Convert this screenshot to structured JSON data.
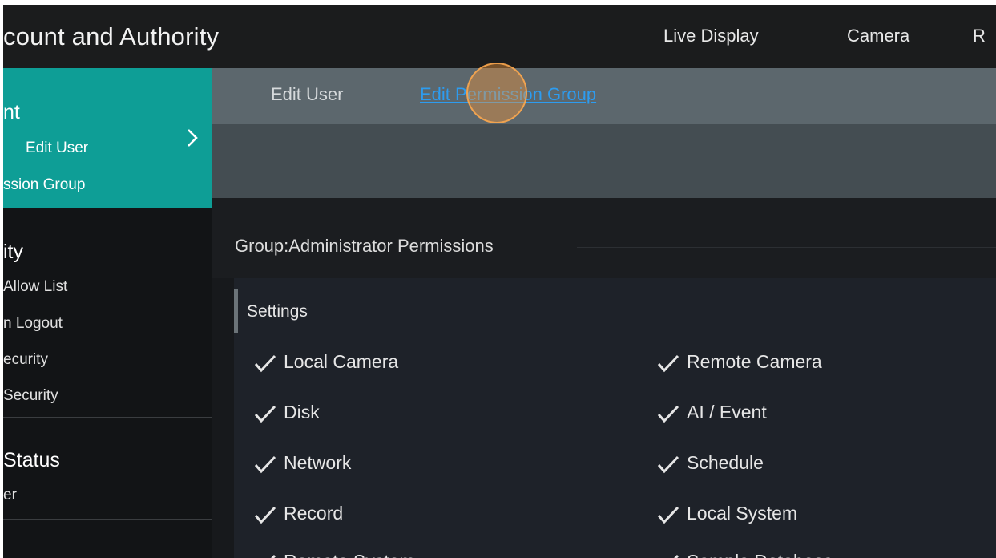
{
  "header": {
    "title": "count and Authority",
    "nav": [
      "Live Display",
      "Camera",
      "R"
    ]
  },
  "sidebar": {
    "sections": [
      {
        "title": "nt",
        "items": [
          "Edit User",
          "ssion Group"
        ]
      },
      {
        "title": "ity",
        "items": [
          "Allow List",
          "n Logout",
          "ecurity",
          "Security"
        ]
      },
      {
        "title": "Status",
        "items": [
          "er"
        ]
      }
    ]
  },
  "tabs": [
    "Edit User",
    "Edit Permission Group"
  ],
  "content": {
    "group_label": "Group:Administrator Permissions",
    "section_title": "Settings",
    "permissions": [
      [
        "Local Camera",
        "Remote Camera"
      ],
      [
        "Disk",
        "AI / Event"
      ],
      [
        "Network",
        "Schedule"
      ],
      [
        "Record",
        "Local System"
      ],
      [
        "Remote System",
        "Sample Database"
      ]
    ]
  },
  "colors": {
    "accent_teal": "#0e9e96",
    "link_blue": "#2d9cf0",
    "cursor_orange": "#f0963c"
  }
}
